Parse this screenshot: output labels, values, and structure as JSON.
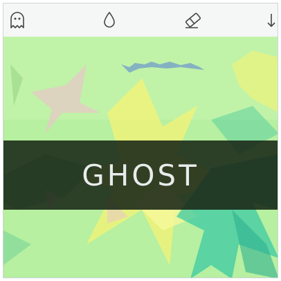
{
  "toolbar": {
    "tools": [
      {
        "icon": "ghost-icon"
      },
      {
        "icon": "droplet-icon"
      },
      {
        "icon": "eraser-icon"
      },
      {
        "icon": "arrow-down-icon"
      }
    ]
  },
  "canvas": {
    "banner_title": "GHOST",
    "colors": {
      "background": "#b6f0a0",
      "yellow": "#eef27a",
      "teal": "#3cc9a3",
      "pink": "#e8c6c8",
      "blue": "#7aa6c6",
      "banner": "#192616"
    }
  }
}
